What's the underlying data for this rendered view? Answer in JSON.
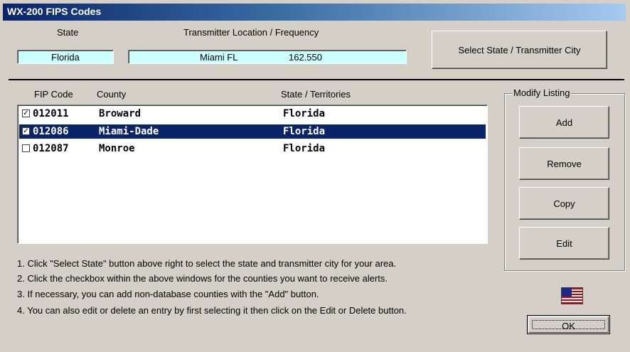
{
  "window": {
    "title": "WX-200 FIPS Codes"
  },
  "header": {
    "state_label": "State",
    "state_value": "Florida",
    "transmitter_label": "Transmitter Location / Frequency",
    "transmitter_location": "Miami FL",
    "transmitter_frequency": "162.550",
    "select_button": "Select State / Transmitter City"
  },
  "list": {
    "columns": [
      "FIP Code",
      "County",
      "State / Territories"
    ],
    "rows": [
      {
        "checked": "✓",
        "code": "012011",
        "county": "Broward",
        "state": "Florida",
        "selected": false
      },
      {
        "checked": "✓",
        "code": "012086",
        "county": "Miami-Dade",
        "state": "Florida",
        "selected": true
      },
      {
        "checked": "",
        "code": "012087",
        "county": "Monroe",
        "state": "Florida",
        "selected": false
      }
    ]
  },
  "modify": {
    "label": "Modify Listing",
    "add": "Add",
    "remove": "Remove",
    "copy": "Copy",
    "edit": "Edit"
  },
  "instructions": [
    "1. Click \"Select State\" button above right to select the state and transmitter city for your area.",
    "2. Click the checkbox within the above windows for the counties you want to receive alerts.",
    "3. If necessary, you can add non-database counties with the \"Add\" button.",
    "4. You can also edit or delete an entry by first selecting it then click on the Edit or Delete button."
  ],
  "footer": {
    "ok": "OK",
    "flag_icon": "us-flag-icon"
  },
  "colors": {
    "title_start": "#0a246a",
    "field_bg": "#ccffff",
    "selection": "#0a246a",
    "face": "#d4d0c8"
  }
}
